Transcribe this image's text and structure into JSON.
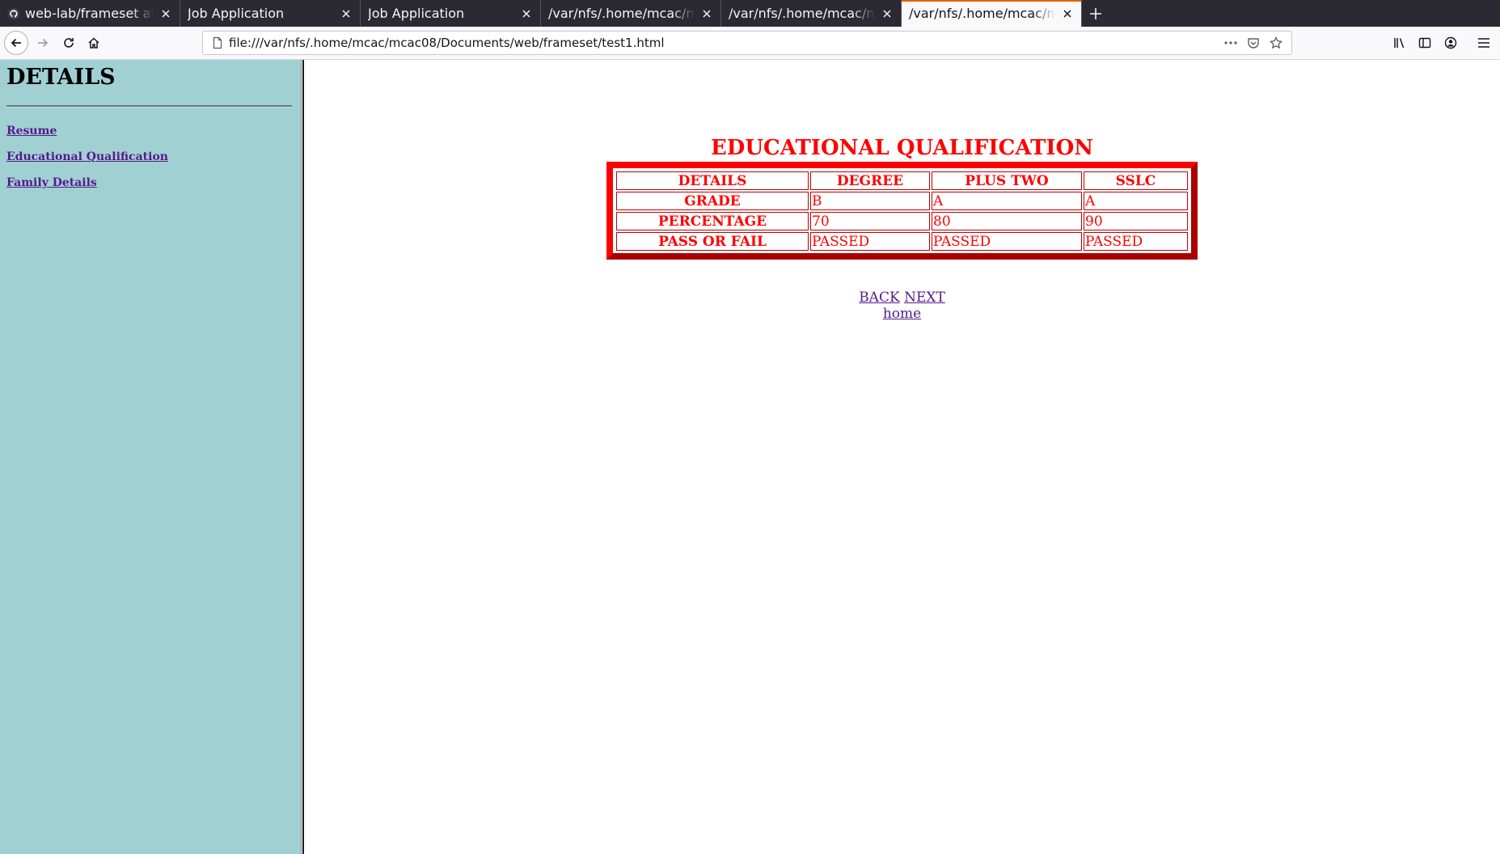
{
  "browser": {
    "tabs": [
      {
        "title": "web-lab/frameset at ma",
        "favicon": "github-icon",
        "active": false
      },
      {
        "title": "Job Application",
        "favicon": "",
        "active": false
      },
      {
        "title": "Job Application",
        "favicon": "",
        "active": false
      },
      {
        "title": "/var/nfs/.home/mcac/mcac",
        "favicon": "",
        "active": false
      },
      {
        "title": "/var/nfs/.home/mcac/mcac",
        "favicon": "",
        "active": false
      },
      {
        "title": "/var/nfs/.home/mcac/mcac",
        "favicon": "",
        "active": true
      }
    ],
    "url": "file:///var/nfs/.home/mcac/mcac08/Documents/web/frameset/test1.html"
  },
  "sidebar": {
    "heading": "DETAILS",
    "links": [
      "Resume",
      "Educational Qualification",
      "Family Details"
    ]
  },
  "main": {
    "heading": "EDUCATIONAL QUALIFICATION",
    "table": {
      "headers": [
        "DETAILS",
        "DEGREE",
        "PLUS TWO",
        "SSLC"
      ],
      "rows": [
        [
          "GRADE",
          "B",
          "A",
          "A"
        ],
        [
          "PERCENTAGE",
          "70",
          "80",
          "90"
        ],
        [
          "PASS OR FAIL",
          "PASSED",
          "PASSED",
          "PASSED"
        ]
      ]
    },
    "nav_links": {
      "back": "BACK",
      "next": "NEXT",
      "home": "home"
    }
  },
  "colors": {
    "sidebar_bg": "#a1d0d3",
    "heading_red": "#ff0000",
    "link_visited": "#551a8b",
    "tab_strip": "#2b2a33"
  }
}
